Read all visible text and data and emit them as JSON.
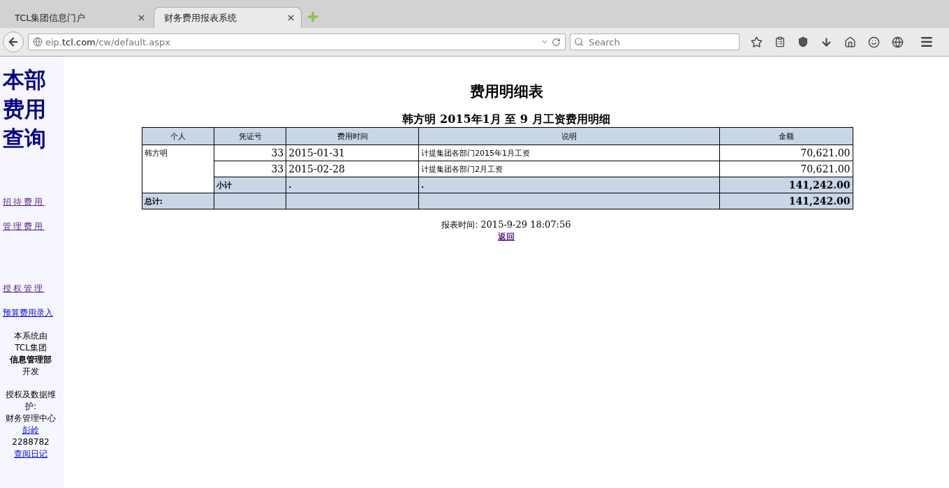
{
  "tabs": [
    {
      "label": "TCL集团信息门户",
      "selected": false
    },
    {
      "label": "财务费用报表系统",
      "selected": true
    }
  ],
  "address": {
    "host_prefix": "eip.",
    "host": "tcl.com",
    "path": "/cw/default.aspx"
  },
  "search": {
    "placeholder": "Search"
  },
  "sidebar": {
    "title": "本部费用查询",
    "links": [
      {
        "label": "招待费用",
        "visited": true,
        "spaced": true
      },
      {
        "label": "管理费用",
        "visited": true,
        "spaced": true
      }
    ],
    "admin_links": [
      {
        "label": "授权管理",
        "visited": true,
        "spaced": true
      },
      {
        "label": "预算费用录入",
        "visited": false,
        "spaced": false
      }
    ],
    "footer": [
      {
        "kind": "text",
        "text": "本系统由"
      },
      {
        "kind": "text",
        "text": "TCL集团"
      },
      {
        "kind": "bold",
        "text": "信息管理部"
      },
      {
        "kind": "text",
        "text": "开发"
      },
      {
        "kind": "gap"
      },
      {
        "kind": "text",
        "text": "授权及数据维护:"
      },
      {
        "kind": "text",
        "text": "财务管理中心"
      },
      {
        "kind": "link",
        "text": "彭岭"
      },
      {
        "kind": "text",
        "text": "2288782"
      },
      {
        "kind": "link",
        "text": "查阅日记"
      }
    ]
  },
  "report": {
    "title": "费用明细表",
    "subtitle": "韩方明 2015年1月 至 9 月工资费用明细",
    "columns": [
      "个人",
      "凭证号",
      "费用时间",
      "说明",
      "金额"
    ],
    "person": "韩方明",
    "rows": [
      {
        "voucher": "33",
        "date": "2015-01-31",
        "description": "计提集团各部门2015年1月工资",
        "amount": "70,621.00"
      },
      {
        "voucher": "33",
        "date": "2015-02-28",
        "description": "计提集团各部门2月工资",
        "amount": "70,621.00"
      }
    ],
    "subtotal": {
      "label": "小计",
      "date": ".",
      "description": ".",
      "amount": "141,242.00"
    },
    "total": {
      "label": "总计:",
      "amount": "141,242.00"
    },
    "time_label": "报表时间:",
    "time": "2015-9-29 18:07:56",
    "back_link": "返回"
  }
}
